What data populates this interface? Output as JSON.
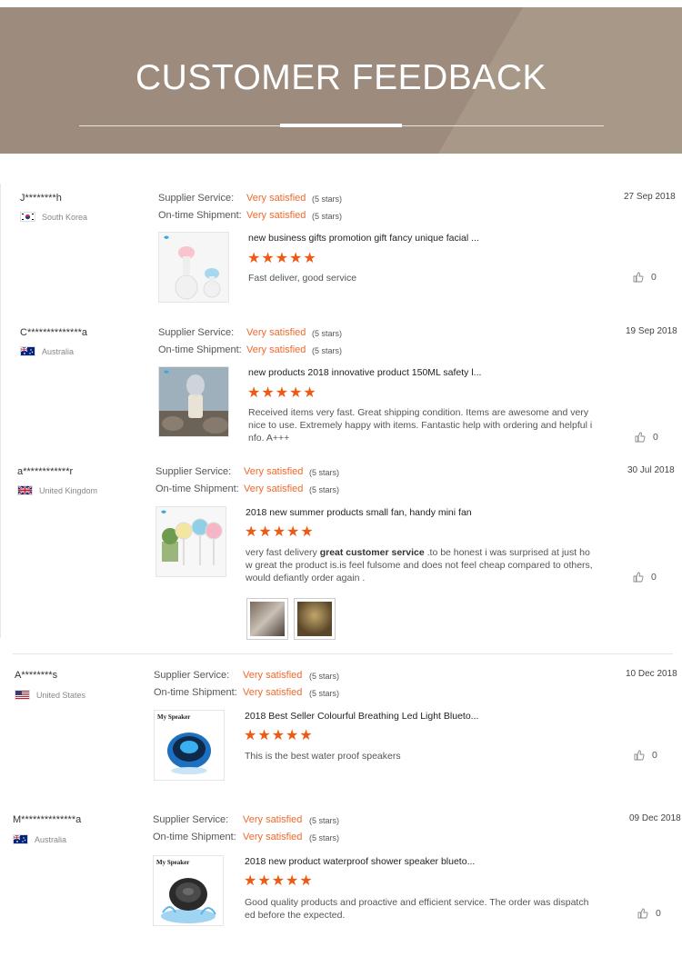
{
  "banner": {
    "title": "CUSTOMER FEEDBACK"
  },
  "labels": {
    "supplier_service": "Supplier Service:",
    "on_time_shipment": "On-time Shipment:"
  },
  "reviews": [
    {
      "user": "J********h",
      "country": "South Korea",
      "date": "27 Sep 2018",
      "supplier_value": "Very satisfied",
      "supplier_stars": "(5 stars)",
      "shipment_value": "Very satisfied",
      "shipment_stars": "(5 stars)",
      "product": "new business gifts promotion gift fancy unique facial ...",
      "rating": "★★★★★",
      "comment": "Fast deliver, good service",
      "likes": "0"
    },
    {
      "user": "C**************a",
      "country": "Australia",
      "date": "19 Sep 2018",
      "supplier_value": "Very satisfied",
      "supplier_stars": "(5 stars)",
      "shipment_value": "Very satisfied",
      "shipment_stars": "(5 stars)",
      "product": "new products 2018 innovative product 150ML safety l...",
      "rating": "★★★★★",
      "comment": "Received items very fast. Great shipping condition.  Items are awesome and very nice to use. Extremely happy with items. Fantastic help with ordering and helpful info. A+++",
      "likes": "0"
    },
    {
      "user": "a************r",
      "country": "United Kingdom",
      "date": "30 Jul 2018",
      "supplier_value": "Very satisfied",
      "supplier_stars": "(5 stars)",
      "shipment_value": "Very satisfied",
      "shipment_stars": "(5 stars)",
      "product": "2018 new summer products small fan, handy mini fan",
      "rating": "★★★★★",
      "comment_pre": "very fast delivery ",
      "comment_bold": "great customer service",
      "comment_post": " .to be honest i was surprised at just how great the product is.is feel fulsome and does not feel cheap compared to others,would defiantly order again .",
      "likes": "0"
    },
    {
      "user": "A********s",
      "country": "United States",
      "date": "10 Dec 2018",
      "supplier_value": "Very satisfied",
      "supplier_stars": "(5 stars)",
      "shipment_value": "Very satisfied",
      "shipment_stars": "(5 stars)",
      "product": "2018 Best Seller Colourful Breathing Led Light Blueto...",
      "thumb_label": "My Speaker",
      "rating": "★★★★★",
      "comment": "This is the best water proof speakers",
      "likes": "0"
    },
    {
      "user": "M**************a",
      "country": "Australia",
      "date": "09 Dec 2018",
      "supplier_value": "Very satisfied",
      "supplier_stars": "(5 stars)",
      "shipment_value": "Very satisfied",
      "shipment_stars": "(5 stars)",
      "product": "2018 new product waterproof shower speaker blueto...",
      "thumb_label": "My Speaker",
      "rating": "★★★★★",
      "comment": "Good quality products and proactive and efficient service. The order was dispatched before the expected.",
      "likes": "0"
    }
  ],
  "colors": {
    "banner": "#9d8c7d",
    "accent": "#ee6a2c",
    "star": "#ee5a14"
  },
  "icons": {
    "likes": "thumbs-up-icon"
  }
}
